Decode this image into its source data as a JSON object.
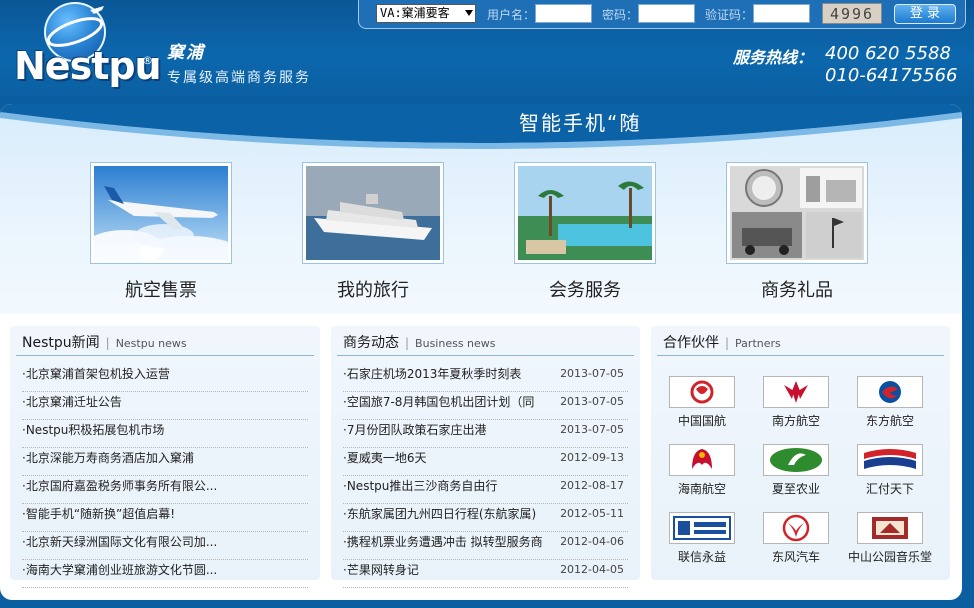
{
  "brand": {
    "logo_text": "Nestpu",
    "registered": "®",
    "name_cn": "窠浦",
    "tagline": "专属级高端商务服务"
  },
  "login": {
    "select_value": "VA:窠浦要客",
    "username_label": "用户名：",
    "password_label": "密码：",
    "captcha_label": "验证码：",
    "captcha_code": "4996",
    "submit_label": "登 录"
  },
  "hotline": {
    "label": "服务热线：",
    "phone_1": "400 620 5588",
    "phone_2": "010-64175566"
  },
  "banner": {
    "scroll_text": "智能手机“随"
  },
  "services": [
    {
      "label": "航空售票"
    },
    {
      "label": "我的旅行"
    },
    {
      "label": "会务服务"
    },
    {
      "label": "商务礼品"
    }
  ],
  "news_panel": {
    "title": "Nestpu新闻",
    "subtitle": "Nestpu news",
    "items": [
      "北京窠浦首架包机投入运营",
      "北京窠浦迁址公告",
      "Nestpu积极拓展包机市场",
      "北京深能万寿商务酒店加入窠浦",
      "北京国府嘉盈税务师事务所有限公...",
      "智能手机“随新换”超值启幕!",
      "北京新天绿洲国际文化有限公司加...",
      "海南大学窠浦创业班旅游文化节圆..."
    ]
  },
  "business_panel": {
    "title": "商务动态",
    "subtitle": "Business news",
    "items": [
      {
        "text": "石家庄机场2013年夏秋季时刻表",
        "date": "2013-07-05"
      },
      {
        "text": "空国旅7-8月韩国包机出团计划（同",
        "date": "2013-07-05"
      },
      {
        "text": "7月份团队政策石家庄出港",
        "date": "2013-07-05"
      },
      {
        "text": "夏威夷一地6天",
        "date": "2012-09-13"
      },
      {
        "text": "Nestpu推出三沙商务自由行",
        "date": "2012-08-17"
      },
      {
        "text": "东航家属团九州四日行程(东航家属)",
        "date": "2012-05-11"
      },
      {
        "text": "携程机票业务遭遇冲击 拟转型服务商",
        "date": "2012-04-06"
      },
      {
        "text": "芒果网转身记",
        "date": "2012-04-05"
      }
    ]
  },
  "partners_panel": {
    "title": "合作伙伴",
    "subtitle": "Partners",
    "items": [
      {
        "name": "中国国航",
        "icon": "air-china-logo-icon",
        "color": "#d2232a"
      },
      {
        "name": "南方航空",
        "icon": "china-southern-logo-icon",
        "color": "#c8102e"
      },
      {
        "name": "东方航空",
        "icon": "china-eastern-logo-icon",
        "color": "#0a4fa0"
      },
      {
        "name": "海南航空",
        "icon": "hainan-airlines-logo-icon",
        "color": "#c8102e"
      },
      {
        "name": "夏至农业",
        "icon": "leaf-logo-icon",
        "color": "#2e8b2e"
      },
      {
        "name": "汇付天下",
        "icon": "chinapnr-logo-icon",
        "color": "#1a3f8f"
      },
      {
        "name": "联信永益",
        "icon": "surekam-logo-icon",
        "color": "#1a4fa0"
      },
      {
        "name": "东风汽车",
        "icon": "dongfeng-logo-icon",
        "color": "#d2232a"
      },
      {
        "name": "中山公园音乐堂",
        "icon": "concert-hall-logo-icon",
        "color": "#a52a2a"
      }
    ]
  },
  "colors": {
    "header_blue": "#0c67ad",
    "panel_bg": "#eef5fb",
    "rule": "#8fb3d3"
  }
}
